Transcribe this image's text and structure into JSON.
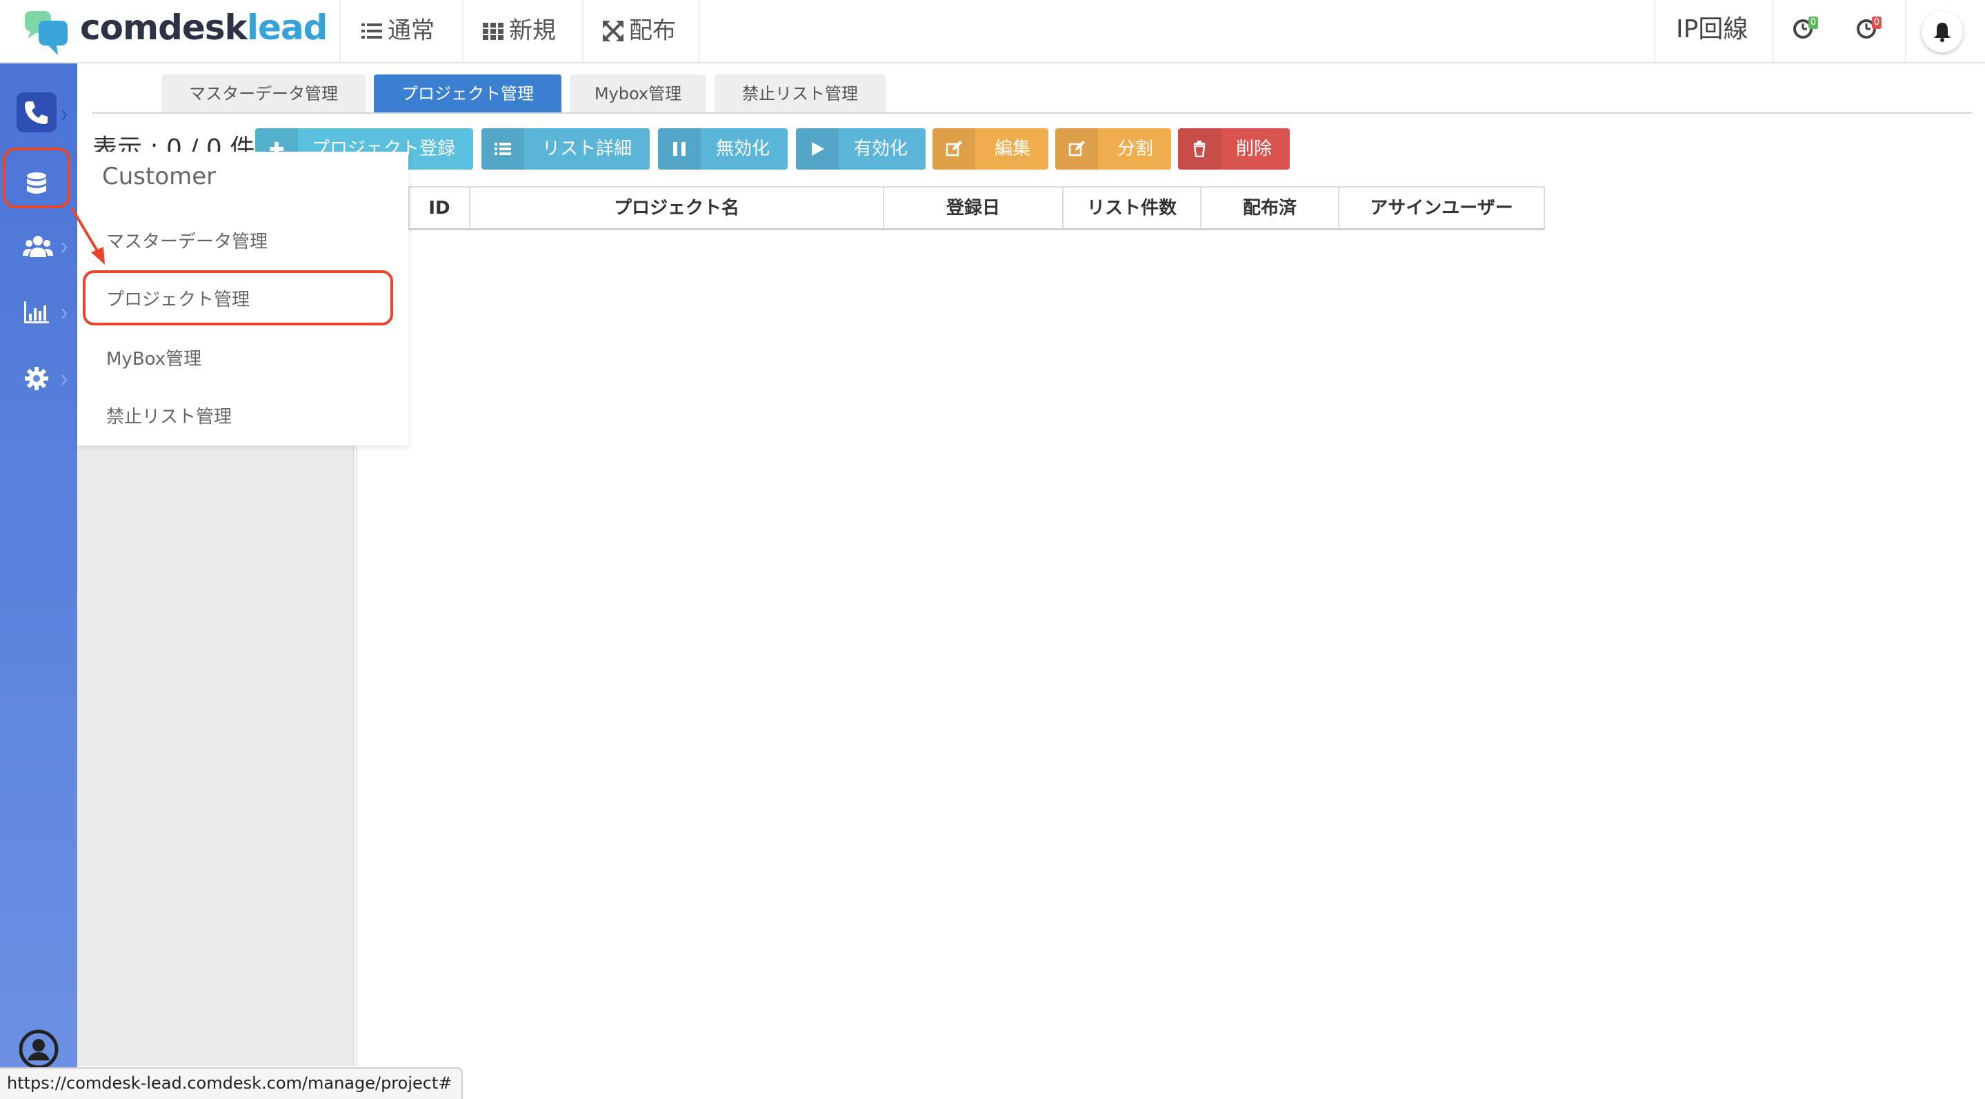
{
  "brand": {
    "part1": "comdesk",
    "part2": "lead"
  },
  "topnav": [
    {
      "label": "通常",
      "icon": "list-icon"
    },
    {
      "label": "新規",
      "icon": "grid-icon"
    },
    {
      "label": "配布",
      "icon": "expand-icon"
    }
  ],
  "topright": {
    "ip_label": "IP回線",
    "clock1_badge": "0",
    "clock2_badge": "0"
  },
  "colors": {
    "accent": "#3a7fd0",
    "rail": "#4a74d6",
    "highlight": "#e8462a",
    "badge_green": "#5cb85c",
    "badge_red": "#d9534f"
  },
  "rail": [
    {
      "name": "phone-icon"
    },
    {
      "name": "database-icon"
    },
    {
      "name": "users-icon"
    },
    {
      "name": "chart-icon"
    },
    {
      "name": "gear-icon"
    }
  ],
  "popup": {
    "title": "Customer",
    "items": [
      "マスターデータ管理",
      "プロジェクト管理",
      "MyBox管理",
      "禁止リスト管理"
    ]
  },
  "tabs": [
    "マスターデータ管理",
    "プロジェクト管理",
    "Mybox管理",
    "禁止リスト管理"
  ],
  "count_label": "表示 : 0 / 0 件",
  "buttons": {
    "register": "プロジェクト登録",
    "list_detail": "リスト詳細",
    "disable": "無効化",
    "enable": "有効化",
    "edit": "編集",
    "split": "分割",
    "delete": "削除"
  },
  "table": {
    "columns": [
      "ID",
      "プロジェクト名",
      "登録日",
      "リスト件数",
      "配布済",
      "アサインユーザー"
    ]
  },
  "status_url": "https://comdesk-lead.comdesk.com/manage/project#"
}
